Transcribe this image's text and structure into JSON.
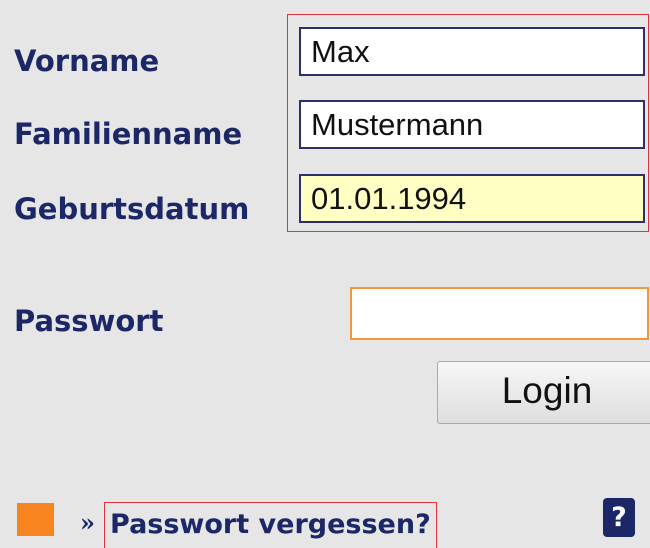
{
  "form": {
    "first_name": {
      "label": "Vorname",
      "value": "Max"
    },
    "last_name": {
      "label": "Familienname",
      "value": "Mustermann"
    },
    "birth_date": {
      "label": "Geburtsdatum",
      "value": "01.01.1994"
    },
    "password": {
      "label": "Passwort",
      "value": ""
    },
    "login_label": "Login"
  },
  "footer": {
    "arrow": "»",
    "forgot_password_label": "Passwort vergessen?",
    "help_label": "?"
  },
  "colors": {
    "label_text": "#1b2767",
    "accent_orange": "#f7841e",
    "highlight_red": "#e0343a",
    "autofill_yellow": "#ffffc4",
    "background": "#e6e6e6"
  }
}
